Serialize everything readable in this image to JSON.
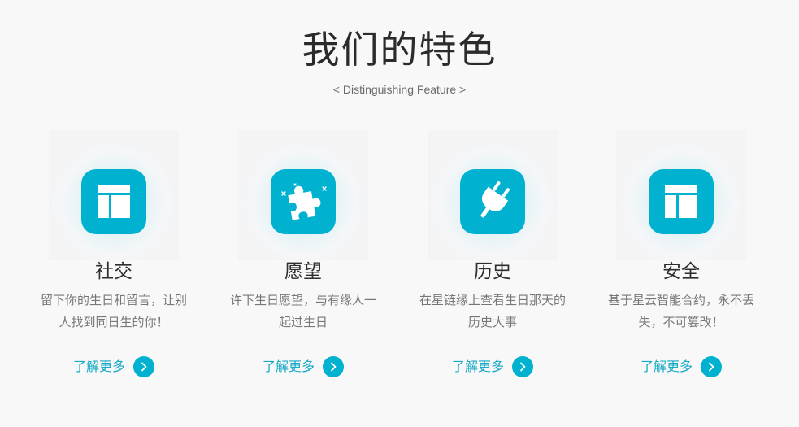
{
  "section": {
    "title": "我们的特色",
    "subtitle": "< Distinguishing Feature >"
  },
  "features": [
    {
      "icon": "layout-icon",
      "title": "社交",
      "desc": "留下你的生日和留言，让别人找到同日生的你！",
      "more_label": "了解更多"
    },
    {
      "icon": "puzzle-icon",
      "title": "愿望",
      "desc": "许下生日愿望，与有缘人一起过生日",
      "more_label": "了解更多"
    },
    {
      "icon": "plug-icon",
      "title": "历史",
      "desc": "在星链缘上查看生日那天的历史大事",
      "more_label": "了解更多"
    },
    {
      "icon": "layout-icon",
      "title": "安全",
      "desc": "基于星云智能合约，永不丢失，不可篡改！",
      "more_label": "了解更多"
    }
  ],
  "colors": {
    "accent": "#01b2d0",
    "link": "#14a9c6",
    "background": "#f8f8f8",
    "title": "#2b2b2b",
    "text": "#777777"
  }
}
